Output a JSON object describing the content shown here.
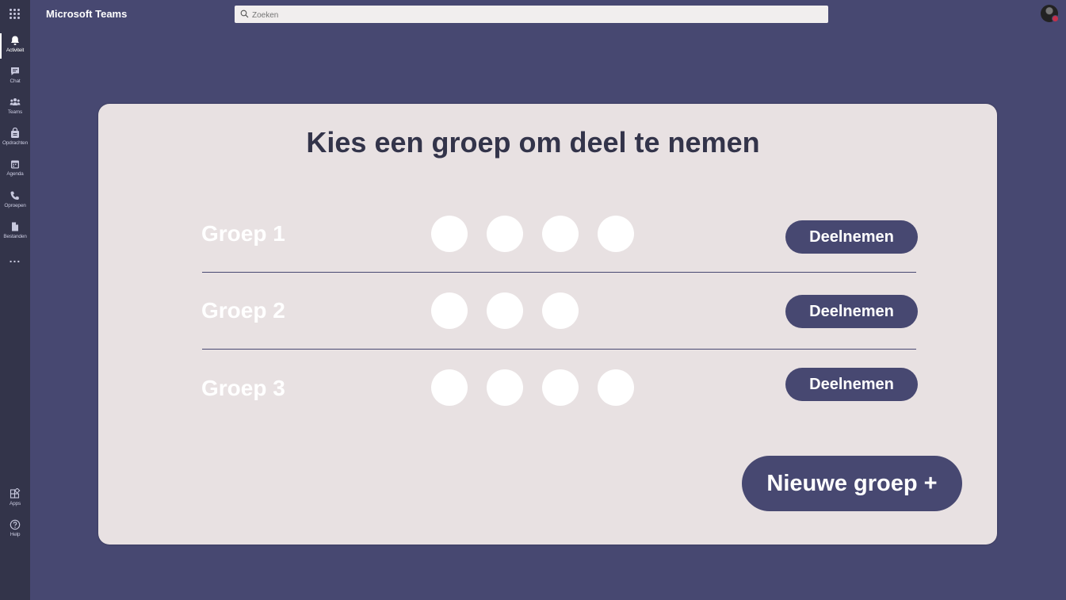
{
  "app": {
    "title": "Microsoft Teams"
  },
  "search": {
    "placeholder": "Zoeken"
  },
  "rail": {
    "top_items": [
      {
        "label": "Activiteit",
        "icon": "bell-icon",
        "active": true
      },
      {
        "label": "Chat",
        "icon": "chat-icon"
      },
      {
        "label": "Teams",
        "icon": "teams-icon"
      },
      {
        "label": "Opdrachten",
        "icon": "assignments-icon"
      },
      {
        "label": "Agenda",
        "icon": "calendar-icon"
      },
      {
        "label": "Oproepen",
        "icon": "phone-icon"
      },
      {
        "label": "Bestanden",
        "icon": "files-icon"
      }
    ],
    "more": "...",
    "bottom_items": [
      {
        "label": "Apps",
        "icon": "apps-icon"
      },
      {
        "label": "Help",
        "icon": "help-icon"
      }
    ]
  },
  "main": {
    "heading": "Kies een groep om deel te nemen",
    "groups": [
      {
        "name": "Groep 1",
        "members": 4,
        "button": "Deelnemen"
      },
      {
        "name": "Groep 2",
        "members": 3,
        "button": "Deelnemen"
      },
      {
        "name": "Groep 3",
        "members": 4,
        "button": "Deelnemen"
      }
    ],
    "new_group_label": "Nieuwe groep +"
  },
  "colors": {
    "background": "#474871",
    "rail": "#33344a",
    "card": "#e8e1e2",
    "accent": "#474871",
    "presence": "#c4314b"
  }
}
